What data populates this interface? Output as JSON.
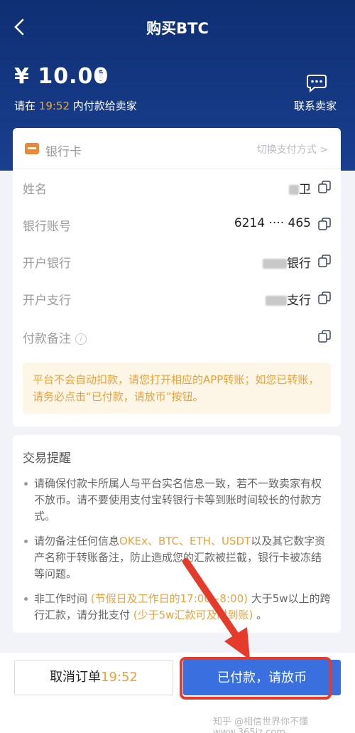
{
  "header": {
    "title": "购买BTC",
    "price": "¥ 10.00",
    "deadline_prefix": "请在 ",
    "deadline_time": "19:52",
    "deadline_suffix": " 内付款给卖家",
    "contact_label": "联系卖家",
    "colors": {
      "background": "#0f2f73",
      "accent": "#f5a623"
    }
  },
  "payment": {
    "method_title": "银行卡",
    "switch_label": "切换支付方式 >",
    "rows": [
      {
        "label": "姓名",
        "value": "卫"
      },
      {
        "label": "银行账号",
        "value": "6214 ···· 465"
      },
      {
        "label": "开户银行",
        "value": "银行"
      },
      {
        "label": "开户支行",
        "value": "支行"
      },
      {
        "label": "付款备注",
        "value": ""
      }
    ],
    "notice": "平台不会自动扣款，请您打开相应的APP转账；如您已转账，请务必点击“已付款，请放币”按钮。"
  },
  "tips": {
    "title": "交易提醒",
    "items": [
      {
        "text": "请确保付款卡所属人与平台实名信息一致，若不一致卖家有权不放币。请不要使用支付宝转银行卡等到账时间较长的付款方式。"
      },
      {
        "pre": "请勿备注任何信息",
        "hl": "OKEx、BTC、ETH、USDT",
        "post": "以及其它数字资产名称于转账备注，防止造成您的汇款被拦截，银行卡被冻结等问题。"
      },
      {
        "pre": "非工作时间",
        "hl": " (节假日及工作日的17:00~8:00) ",
        "mid": "大于5w以上的跨行汇款，请分批支付",
        "hl2": " (少于5w汇款可及时到账) ",
        "post": "。"
      }
    ]
  },
  "footer": {
    "cancel_label": "取消订单",
    "cancel_time": "19:52",
    "confirm_label": "已付款，请放币",
    "watermark": "知乎 @相信世界你不懂  www.365jz.com"
  }
}
